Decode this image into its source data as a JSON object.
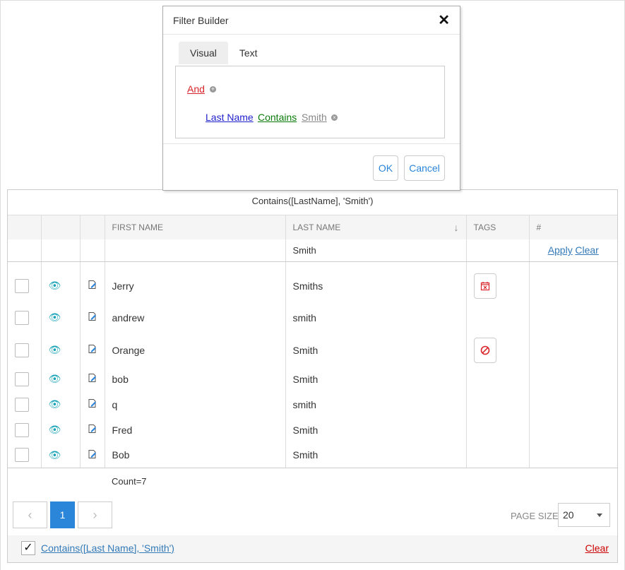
{
  "dialog": {
    "title": "Filter Builder",
    "close_glyph": "✕",
    "tabs": [
      {
        "label": "Visual"
      },
      {
        "label": "Text"
      }
    ],
    "group_operator": "And",
    "condition": {
      "field": "Last Name",
      "operator": "Contains",
      "value": "Smith"
    },
    "ok_label": "OK",
    "cancel_label": "Cancel"
  },
  "grid": {
    "filter_expression": "Contains([LastName], 'Smith')",
    "columns": {
      "first_name": "FIRST NAME",
      "last_name": "LAST NAME",
      "tags": "TAGS",
      "actions": "#"
    },
    "filter_row": {
      "last_name_value": "Smith",
      "apply_label": "Apply",
      "clear_label": "Clear"
    },
    "rows": [
      {
        "first": "Jerry",
        "last": "Smiths",
        "tag": "calendar-x-icon"
      },
      {
        "first": "andrew",
        "last": "smith",
        "tag": ""
      },
      {
        "first": "Orange",
        "last": "Smith",
        "tag": "ban-icon"
      },
      {
        "first": "bob",
        "last": "Smith",
        "tag": ""
      },
      {
        "first": "q",
        "last": "smith",
        "tag": ""
      },
      {
        "first": "Fred",
        "last": "Smith",
        "tag": ""
      },
      {
        "first": "Bob",
        "last": "Smith",
        "tag": ""
      }
    ],
    "count_text": "Count=7",
    "pager": {
      "current_page": "1",
      "prev_glyph": "‹",
      "next_glyph": "›"
    },
    "page_size": {
      "label": "PAGE SIZE",
      "value": "20"
    },
    "footer": {
      "filter_label": "Contains([Last Name], 'Smith')",
      "check_glyph": "✓",
      "clear_label": "Clear"
    }
  },
  "colors": {
    "accent": "#2b85d9",
    "eye": "#17a2b8",
    "danger": "#d9242b"
  }
}
